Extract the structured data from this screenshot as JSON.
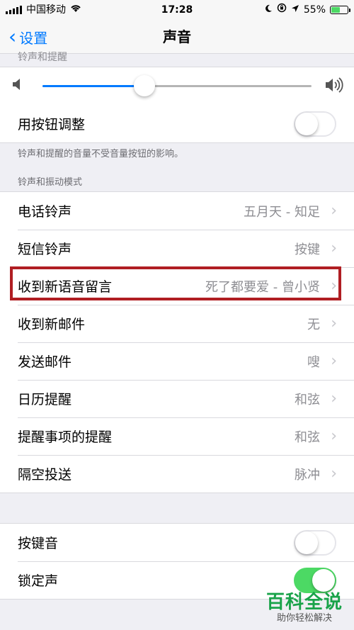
{
  "status_bar": {
    "carrier": "中国移动",
    "time": "17:28",
    "battery_percent": "55%",
    "battery_level": 0.55
  },
  "nav": {
    "back_label": "设置",
    "title": "声音"
  },
  "ringer_section": {
    "header": "铃声和提醒",
    "volume_level": 0.38,
    "adjust_with_buttons": {
      "label": "用按钮调整",
      "on": false
    },
    "footer": "铃声和提醒的音量不受音量按钮的影响。"
  },
  "patterns_section": {
    "header": "铃声和振动模式",
    "items": [
      {
        "label": "电话铃声",
        "value": "五月天 - 知足"
      },
      {
        "label": "短信铃声",
        "value": "按键"
      },
      {
        "label": "收到新语音留言",
        "value": "死了都要爱 - 曾小贤"
      },
      {
        "label": "收到新邮件",
        "value": "无"
      },
      {
        "label": "发送邮件",
        "value": "嗖"
      },
      {
        "label": "日历提醒",
        "value": "和弦"
      },
      {
        "label": "提醒事项的提醒",
        "value": "和弦"
      },
      {
        "label": "隔空投送",
        "value": "脉冲"
      }
    ]
  },
  "bottom_section": {
    "keyboard_clicks": {
      "label": "按键音",
      "on": false
    },
    "lock_sound": {
      "label": "锁定声",
      "on": true
    }
  },
  "watermark": {
    "main": "百科全说",
    "sub": "助你轻松解决"
  },
  "colors": {
    "accent": "#007aff",
    "toggle_on": "#4cd964",
    "highlight_border": "#b01e23",
    "watermark_green": "#1aa34a"
  }
}
